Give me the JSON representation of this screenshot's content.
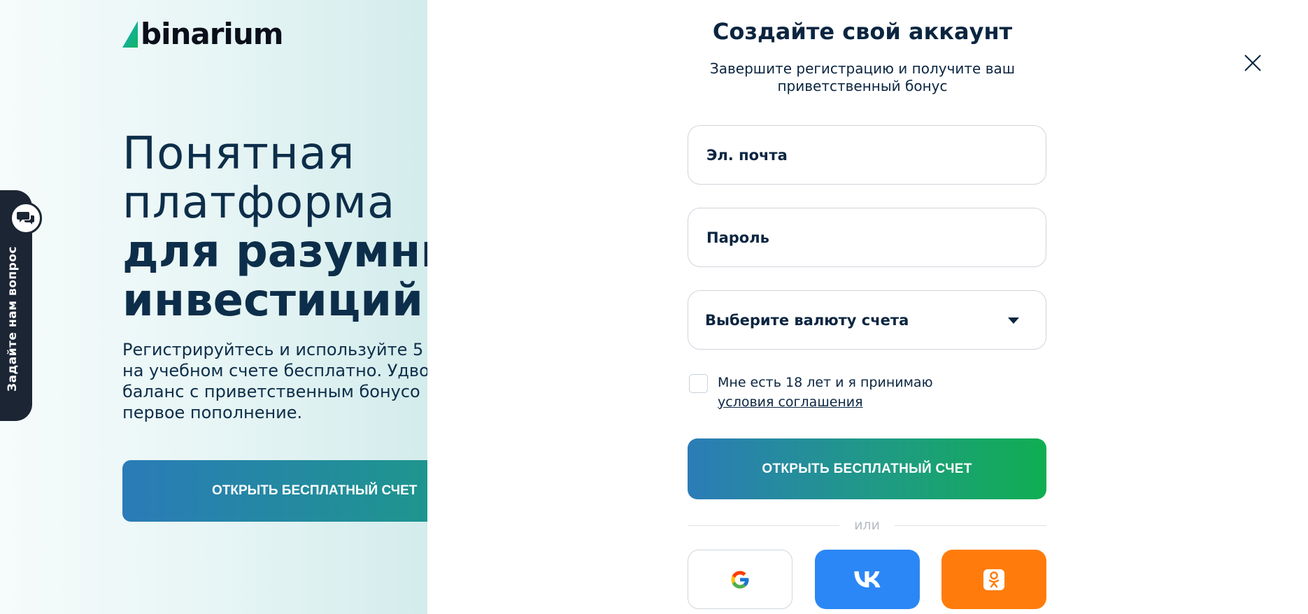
{
  "brand": {
    "name": "binarium"
  },
  "hero": {
    "line1": "Понятная",
    "line2": "платформа",
    "line3": "для разумных",
    "line4": "инвестиций",
    "description": "Регистрируйтесь и используйте 5\nна учебном счете бесплатно. Удво\nбаланс с приветственным бонусо\nпервое пополнение.",
    "cta_label": "ОТКРЫТЬ БЕСПЛАТНЫЙ СЧЕТ"
  },
  "support_tab": {
    "label": "Задайте нам вопрос",
    "icon": "chat-bubbles-icon"
  },
  "signup": {
    "title": "Создайте свой аккаунт",
    "subtitle": "Завершите регистрацию и получите ваш\nприветственный бонус",
    "email_placeholder": "Эл. почта",
    "password_placeholder": "Пароль",
    "currency_label": "Выберите валюту счета",
    "consent_text": "Мне есть 18 лет и я принимаю",
    "consent_link": "условия соглашения",
    "submit_label": "ОТКРЫТЬ БЕСПЛАТНЫЙ СЧЕТ",
    "or_label": "или",
    "social": [
      {
        "name": "google",
        "icon": "google-icon"
      },
      {
        "name": "vk",
        "icon": "vk-icon"
      },
      {
        "name": "ok",
        "icon": "odnoklassniki-icon"
      }
    ]
  },
  "colors": {
    "primary_text": "#0b2540",
    "cta_gradient_start": "#2b7cb7",
    "cta_gradient_end": "#10ae52",
    "vk_blue": "#2b87f5",
    "ok_orange": "#ff7c0c"
  }
}
